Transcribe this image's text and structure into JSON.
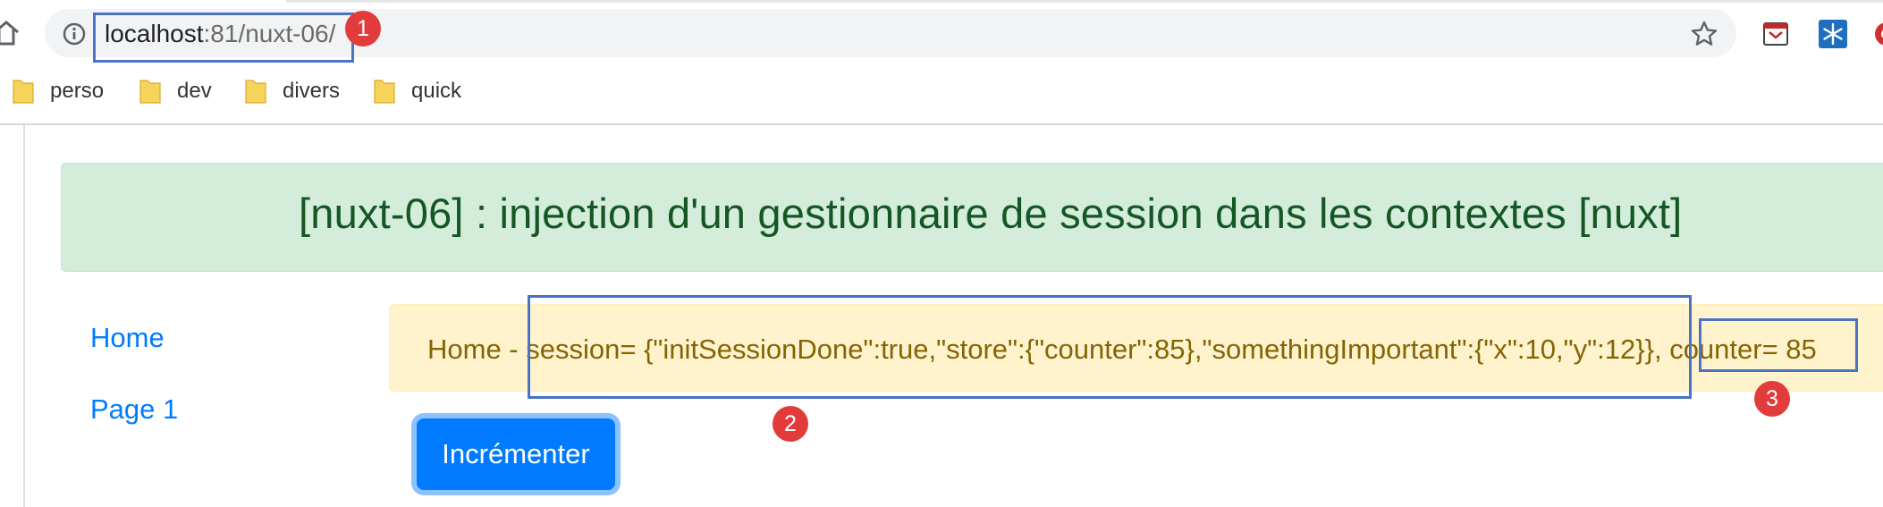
{
  "browser": {
    "url_host": "localhost",
    "url_rest": ":81/nuxt-06/",
    "bookmarks": [
      {
        "label": "perso"
      },
      {
        "label": "dev"
      },
      {
        "label": "divers"
      },
      {
        "label": "quick"
      }
    ]
  },
  "page": {
    "title": "[nuxt-06] : injection d'un gestionnaire de session dans les contextes [nuxt]",
    "nav": [
      {
        "label": "Home"
      },
      {
        "label": "Page 1"
      }
    ],
    "alert": {
      "prefix": "Home - ",
      "session": "session= {\"initSessionDone\":true,\"store\":{\"counter\":85},\"somethingImportant\":{\"x\":10,\"y\":12}},",
      "counter": "counter= 85"
    },
    "increment_button": "Incrémenter"
  },
  "annotations": [
    {
      "number": "1"
    },
    {
      "number": "2"
    },
    {
      "number": "3"
    }
  ],
  "colors": {
    "jumbotron_bg": "#d4edda",
    "jumbotron_text": "#155724",
    "alert_bg": "#fff3cd",
    "alert_text": "#856404",
    "link": "#007bff",
    "button": "#007bff",
    "annotation_box": "#4a73c6",
    "annotation_badge": "#e23b3b"
  }
}
